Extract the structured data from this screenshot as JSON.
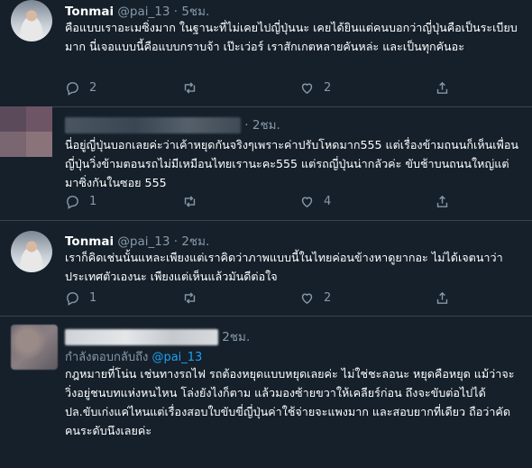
{
  "tweets": [
    {
      "name": "Tonmai",
      "handle": "@pai_13",
      "dot": "·",
      "time": "5ชม.",
      "text": "คือแบบเราอะเมซิ่งมาก ในฐานะที่ไม่เคยไปญี่ปุ่นนะ เคยได้ยินแต่คนบอกว่าญี่ปุ่นคือเป็นระเบียบมาก นี่เจอแบบนี้คือแบบกราบจ้า เป๊ะเว่อร์ เราสักเกตหลายคันหล่ะ และเป็นทุกคันอะ",
      "reply_count": "2",
      "retweet_count": "",
      "like_count": "2"
    },
    {
      "name": "",
      "handle": "",
      "dot": "·",
      "time": "2ชม.",
      "text": "นี่อยู่ญี่ปุ่นบอกเลยค่ะว่าเค้าหยุดกันจริงๆเพราะค่าปรับโหดมาก555 แต่เรื่องข้ามถนนก็เห็นเพื่อนญี่ปุ่นวิ่งข้ามตอนรถไม่มีเหมือนไทยเรานะคะ555 แต่รถญี่ปุ่นน่ากลัวค่ะ ขับช้าบนถนนใหญ่แต่มาซิ่งกันในซอย 555",
      "reply_count": "1",
      "retweet_count": "",
      "like_count": "4"
    },
    {
      "name": "Tonmai",
      "handle": "@pai_13",
      "dot": "·",
      "time": "2ชม.",
      "text": "เราก็คิดเช่นนั้นแหละเพียงแต่เราคิดว่าภาพแบบนี้ในไทยค่อนข้างหาดูยากอะ ไม่ได้เจตนาว่าประเทศตัวเองนะ เพียงแต่เห็นแล้วมันดีต่อใจ",
      "reply_count": "1",
      "retweet_count": "",
      "like_count": "2"
    },
    {
      "name": "",
      "handle": "",
      "dot": "",
      "time": "2ชม.",
      "reply_prefix": "กำลังตอบกลับถึง",
      "reply_mention": "@pai_13",
      "text": "กฎหมายที่โน่น เช่นทางรถไฟ รถต้องหยุดแบบหยุดเลยค่ะ ไม่ใช่ชะลอนะ หยุดคือหยุด แม้ว่าจะวิ่งอยู่ชนบทแห่งหนไหน โล่งยังไงก็ตาม แล้วมองซ้ายขวาให้เคลียร์ก่อน ถึงจะขับต่อไปได้ ปล.ขับเก่งแค่ไหนแต่เรื่องสอบใบขับขี่ญี่ปุ่นค่าใช้จ่ายจะแพงมาก และสอบยากที่เดียว ถือว่าคัดคนระดับนึงเลยค่ะ"
    }
  ],
  "icons": {
    "reply": "reply-icon",
    "retweet": "retweet-icon",
    "like": "heart-icon",
    "share": "share-icon"
  },
  "colors": {
    "background": "#15202b",
    "secondary_text": "#8899a6",
    "link": "#1da1f2",
    "divider": "#38444d"
  }
}
